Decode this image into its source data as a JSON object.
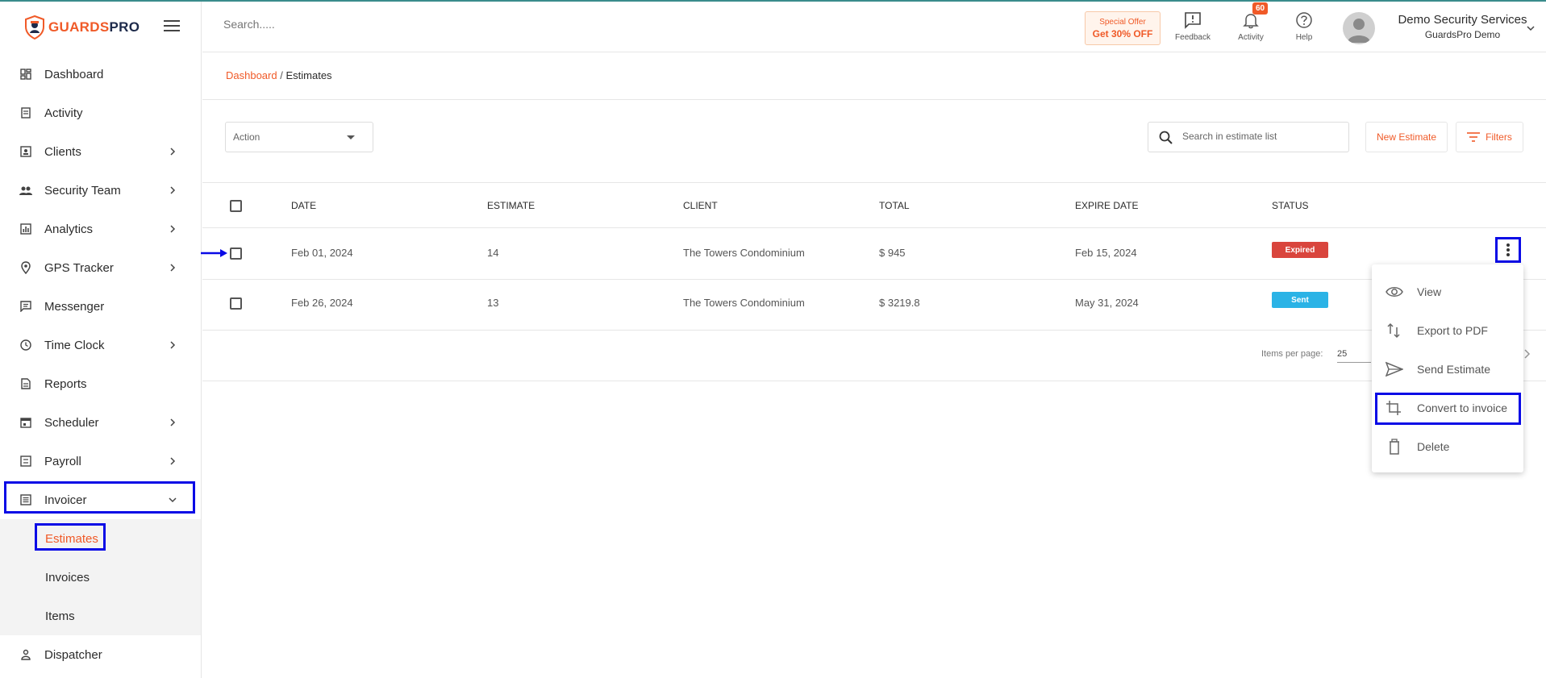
{
  "brand": {
    "name_part1": "GUARDS",
    "name_part2": "PRO",
    "accent": "#f05a28",
    "dark": "#1d2a4a"
  },
  "sidebar": {
    "items": [
      {
        "label": "Dashboard",
        "icon": "dashboard-icon",
        "has_children": false
      },
      {
        "label": "Activity",
        "icon": "activity-icon",
        "has_children": false
      },
      {
        "label": "Clients",
        "icon": "clients-icon",
        "has_children": true
      },
      {
        "label": "Security Team",
        "icon": "team-icon",
        "has_children": true
      },
      {
        "label": "Analytics",
        "icon": "analytics-icon",
        "has_children": true
      },
      {
        "label": "GPS Tracker",
        "icon": "location-pin-icon",
        "has_children": true
      },
      {
        "label": "Messenger",
        "icon": "chat-icon",
        "has_children": false
      },
      {
        "label": "Time Clock",
        "icon": "clock-icon",
        "has_children": true
      },
      {
        "label": "Reports",
        "icon": "report-icon",
        "has_children": false
      },
      {
        "label": "Scheduler",
        "icon": "calendar-icon",
        "has_children": true
      },
      {
        "label": "Payroll",
        "icon": "payroll-icon",
        "has_children": true
      },
      {
        "label": "Invoicer",
        "icon": "invoice-icon",
        "has_children": true,
        "expanded": true
      },
      {
        "label": "Dispatcher",
        "icon": "dispatcher-icon",
        "has_children": false
      }
    ],
    "invoicer_sub": [
      {
        "label": "Estimates",
        "active": true
      },
      {
        "label": "Invoices"
      },
      {
        "label": "Items"
      }
    ]
  },
  "header": {
    "search_placeholder": "Search.....",
    "offer": {
      "line1": "Special Offer",
      "line2": "Get 30% OFF"
    },
    "feedback_label": "Feedback",
    "activity_label": "Activity",
    "activity_badge": "60",
    "help_label": "Help",
    "user_name": "Demo Security Services",
    "user_org": "GuardsPro Demo"
  },
  "breadcrumb": {
    "root": "Dashboard",
    "separator": "/",
    "current": "Estimates"
  },
  "toolbar": {
    "action_label": "Action",
    "search_placeholder": "Search in estimate list",
    "new_label": "New Estimate",
    "filters_label": "Filters"
  },
  "table": {
    "headers": [
      "DATE",
      "ESTIMATE",
      "CLIENT",
      "TOTAL",
      "EXPIRE DATE",
      "STATUS"
    ],
    "rows": [
      {
        "date": "Feb 01, 2024",
        "estimate": "14",
        "client": "The Towers Condominium",
        "total": "$ 945",
        "expire": "Feb 15, 2024",
        "status": "Expired",
        "status_color": "#d9453d"
      },
      {
        "date": "Feb 26, 2024",
        "estimate": "13",
        "client": "The Towers Condominium",
        "total": "$ 3219.8",
        "expire": "May 31, 2024",
        "status": "Sent",
        "status_color": "#2bb3e6"
      }
    ]
  },
  "pagination": {
    "label": "Items per page:",
    "value": "25"
  },
  "row_menu": {
    "items": [
      {
        "label": "View",
        "icon": "eye-icon"
      },
      {
        "label": "Export to PDF",
        "icon": "export-arrows-icon"
      },
      {
        "label": "Send Estimate",
        "icon": "send-icon"
      },
      {
        "label": "Convert to invoice",
        "icon": "crop-convert-icon"
      },
      {
        "label": "Delete",
        "icon": "trash-icon"
      }
    ]
  }
}
